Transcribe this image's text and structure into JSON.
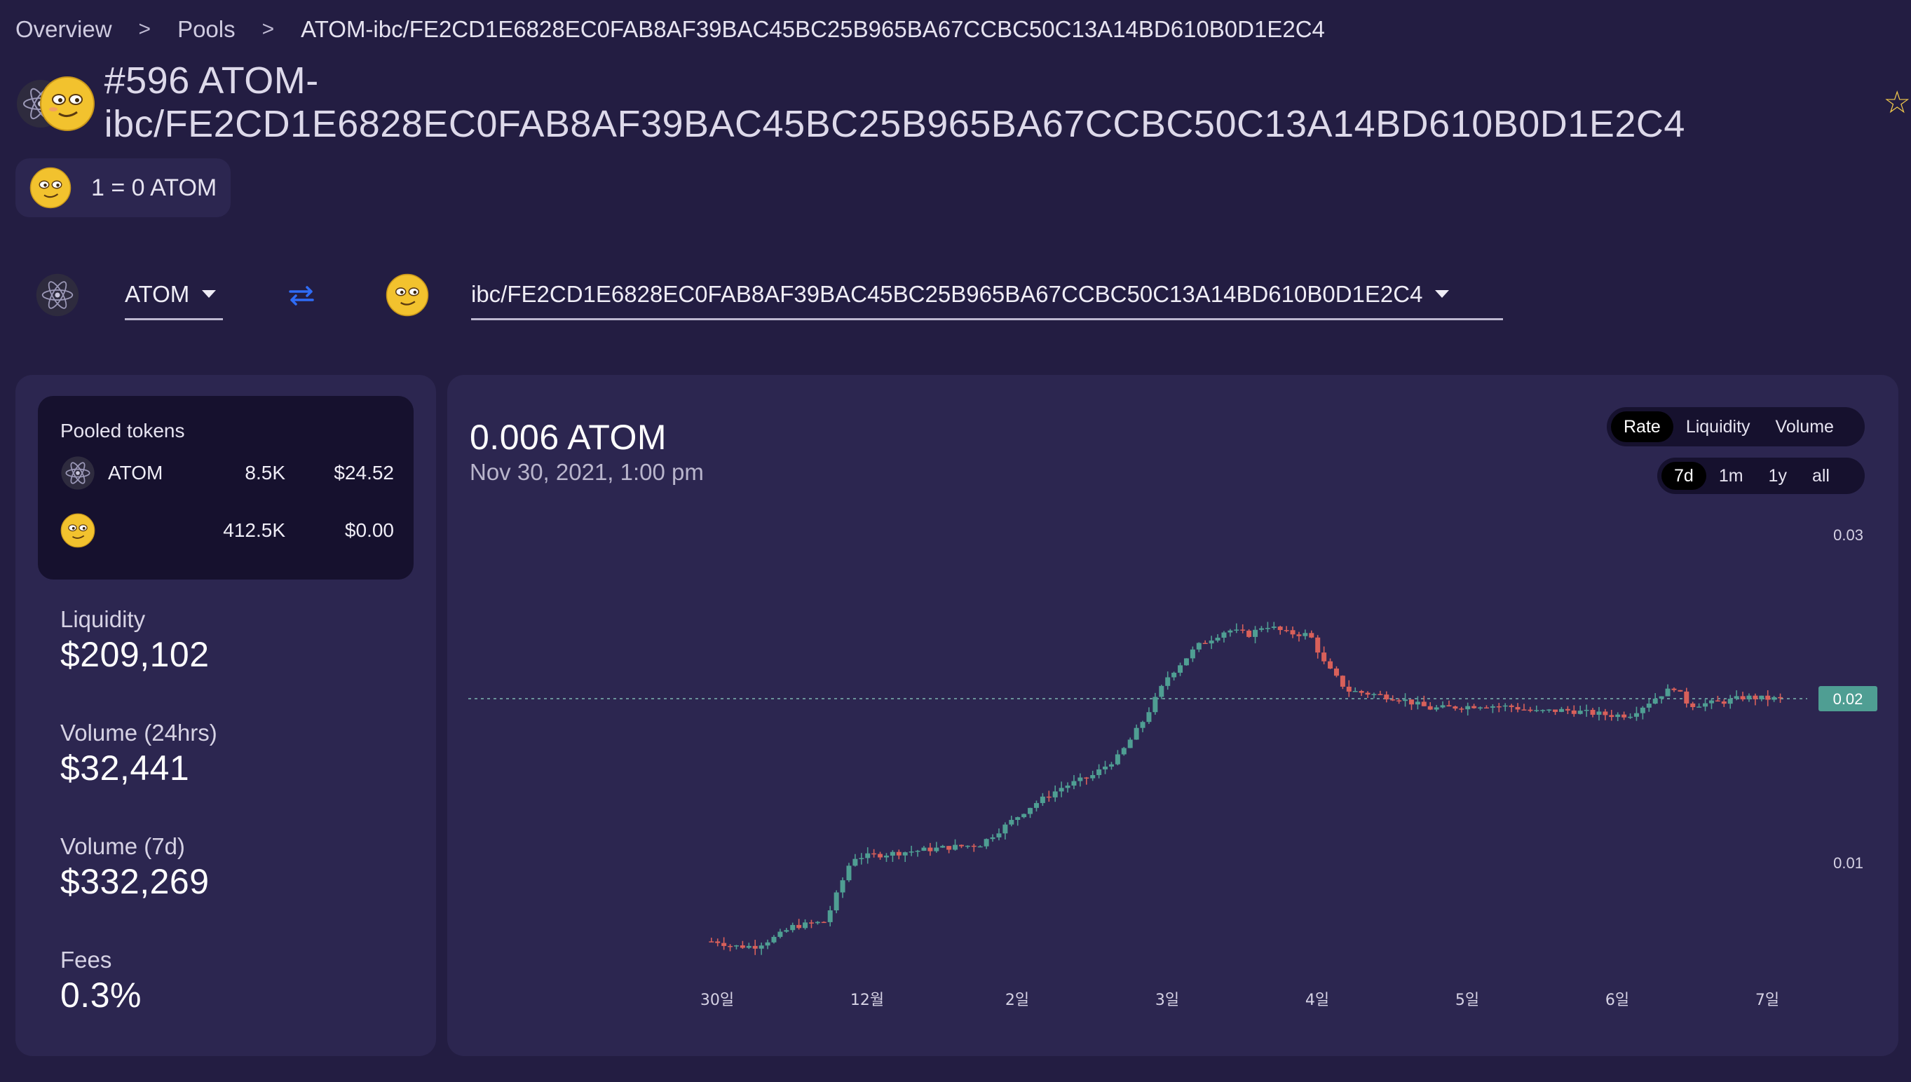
{
  "breadcrumb": {
    "overview": "Overview",
    "pools": "Pools",
    "current": "ATOM-ibc/FE2CD1E6828EC0FAB8AF39BAC45BC25B965BA67CCBC50C13A14BD610B0D1E2C4",
    "separator": ">"
  },
  "title": {
    "text": "#596 ATOM-ibc/FE2CD1E6828EC0FAB8AF39BAC45BC25B965BA67CCBC50C13A14BD610B0D1E2C4",
    "star": "☆"
  },
  "rate_pill": {
    "text": "1 = 0 ATOM"
  },
  "selector": {
    "from_token": "ATOM",
    "to_token": "ibc/FE2CD1E6828EC0FAB8AF39BAC45BC25B965BA67CCBC50C13A14BD610B0D1E2C4"
  },
  "pooled": {
    "label": "Pooled tokens",
    "rows": [
      {
        "symbol": "ATOM",
        "amount": "8.5K",
        "usd": "$24.52"
      },
      {
        "symbol": "",
        "amount": "412.5K",
        "usd": "$0.00"
      }
    ]
  },
  "stats": {
    "liquidity": {
      "label": "Liquidity",
      "value": "$209,102"
    },
    "volume_24h": {
      "label": "Volume (24hrs)",
      "value": "$32,441"
    },
    "volume_7d": {
      "label": "Volume (7d)",
      "value": "$332,269"
    },
    "fees": {
      "label": "Fees",
      "value": "0.3%"
    }
  },
  "chart_header": {
    "price": "0.006 ATOM",
    "date": "Nov 30, 2021, 1:00 pm"
  },
  "tabs": {
    "metric": [
      "Rate",
      "Liquidity",
      "Volume"
    ],
    "active_metric": "Rate",
    "range": [
      "7d",
      "1m",
      "1y",
      "all"
    ],
    "active_range": "7d"
  },
  "colors": {
    "up": "#4f9e93",
    "down": "#d9605a",
    "accent": "#2f6cf6",
    "badge": "#4f9e93"
  },
  "chart_data": {
    "type": "candlestick",
    "x_tick_labels": [
      "30일",
      "12월",
      "2일",
      "3일",
      "4일",
      "5일",
      "6일",
      "7일"
    ],
    "y_tick_labels": [
      "0.03",
      "0.02",
      "0.01"
    ],
    "y_ticks": [
      0.03,
      0.02,
      0.01
    ],
    "ylim": [
      0.0043,
      0.0313
    ],
    "current_value": 0.02,
    "current_label": "0.02",
    "close_path": [
      [
        -0.08,
        0.0052
      ],
      [
        0.0,
        0.0052
      ],
      [
        0.1,
        0.0049
      ],
      [
        0.25,
        0.0049
      ],
      [
        0.4,
        0.0055
      ],
      [
        0.5,
        0.0061
      ],
      [
        0.72,
        0.0064
      ],
      [
        0.9,
        0.0103
      ],
      [
        1.2,
        0.0106
      ],
      [
        1.5,
        0.0109
      ],
      [
        1.75,
        0.0111
      ],
      [
        1.9,
        0.0121
      ],
      [
        2.1,
        0.0135
      ],
      [
        2.3,
        0.0146
      ],
      [
        2.5,
        0.0153
      ],
      [
        2.68,
        0.0165
      ],
      [
        2.85,
        0.0188
      ],
      [
        3.0,
        0.0213
      ],
      [
        3.2,
        0.0232
      ],
      [
        3.4,
        0.0242
      ],
      [
        3.55,
        0.0239
      ],
      [
        3.65,
        0.0245
      ],
      [
        3.8,
        0.024
      ],
      [
        3.95,
        0.0239
      ],
      [
        4.05,
        0.0221
      ],
      [
        4.2,
        0.0205
      ],
      [
        4.35,
        0.0203
      ],
      [
        4.55,
        0.02
      ],
      [
        4.75,
        0.0194
      ],
      [
        4.95,
        0.0195
      ],
      [
        5.1,
        0.0196
      ],
      [
        5.3,
        0.0195
      ],
      [
        5.45,
        0.0192
      ],
      [
        5.65,
        0.0193
      ],
      [
        5.85,
        0.0191
      ],
      [
        5.95,
        0.019
      ],
      [
        6.08,
        0.019
      ],
      [
        6.18,
        0.0196
      ],
      [
        6.28,
        0.0202
      ],
      [
        6.38,
        0.0207
      ],
      [
        6.48,
        0.0196
      ],
      [
        6.7,
        0.0198
      ],
      [
        6.85,
        0.0201
      ],
      [
        7.0,
        0.02
      ],
      [
        7.12,
        0.02
      ]
    ]
  }
}
